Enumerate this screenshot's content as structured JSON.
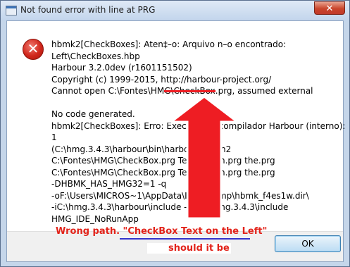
{
  "window": {
    "title": "Not found error with line at PRG",
    "close_glyph": "✕"
  },
  "icon": {
    "name": "error-icon",
    "glyph": "✕",
    "color": "#d0261b"
  },
  "message": {
    "lines": [
      "hbmk2[CheckBoxes]: Aten‡–o: Arquivo n–o encontrado:",
      "Left\\CheckBoxes.hbp",
      "Harbour 3.2.0dev (r1601151502)",
      "Copyright (c) 1999-2015, http://harbour-project.org/",
      "Cannot open C:\\Fontes\\HMG\\CheckBox.prg, assumed external",
      "",
      "No code generated.",
      "hbmk2[CheckBoxes]: Erro: Executando compilador Harbour (interno):",
      "1",
      "(C:\\hmg.3.4.3\\harbour\\bin\\harbour.exe -n2",
      "C:\\Fontes\\HMG\\CheckBox.prg Text.prg on.prg the.prg",
      "C:\\Fontes\\HMG\\CheckBox.prg Text.prg on.prg the.prg",
      "-DHBMK_HAS_HMG32=1 -q",
      "-oF:\\Users\\MICROS~1\\AppData\\Local\\Temp\\hbmk_f4es1w.dir\\",
      "-iC:\\hmg.3.4.3\\harbour\\include -i. -iC:\\hmg.3.4.3\\include",
      "HMG_IDE_NoRunApp"
    ]
  },
  "annotation": {
    "line1": "Wrong path. \"CheckBox Text on the Left\"",
    "line2": "should it be",
    "color": "#e2231a",
    "underline_color": "#3333cc"
  },
  "buttons": {
    "ok_label": "OK"
  },
  "colors": {
    "frame": "#c5d6ea",
    "footer": "#f0f0f0",
    "arrow": "#ee1d23"
  }
}
